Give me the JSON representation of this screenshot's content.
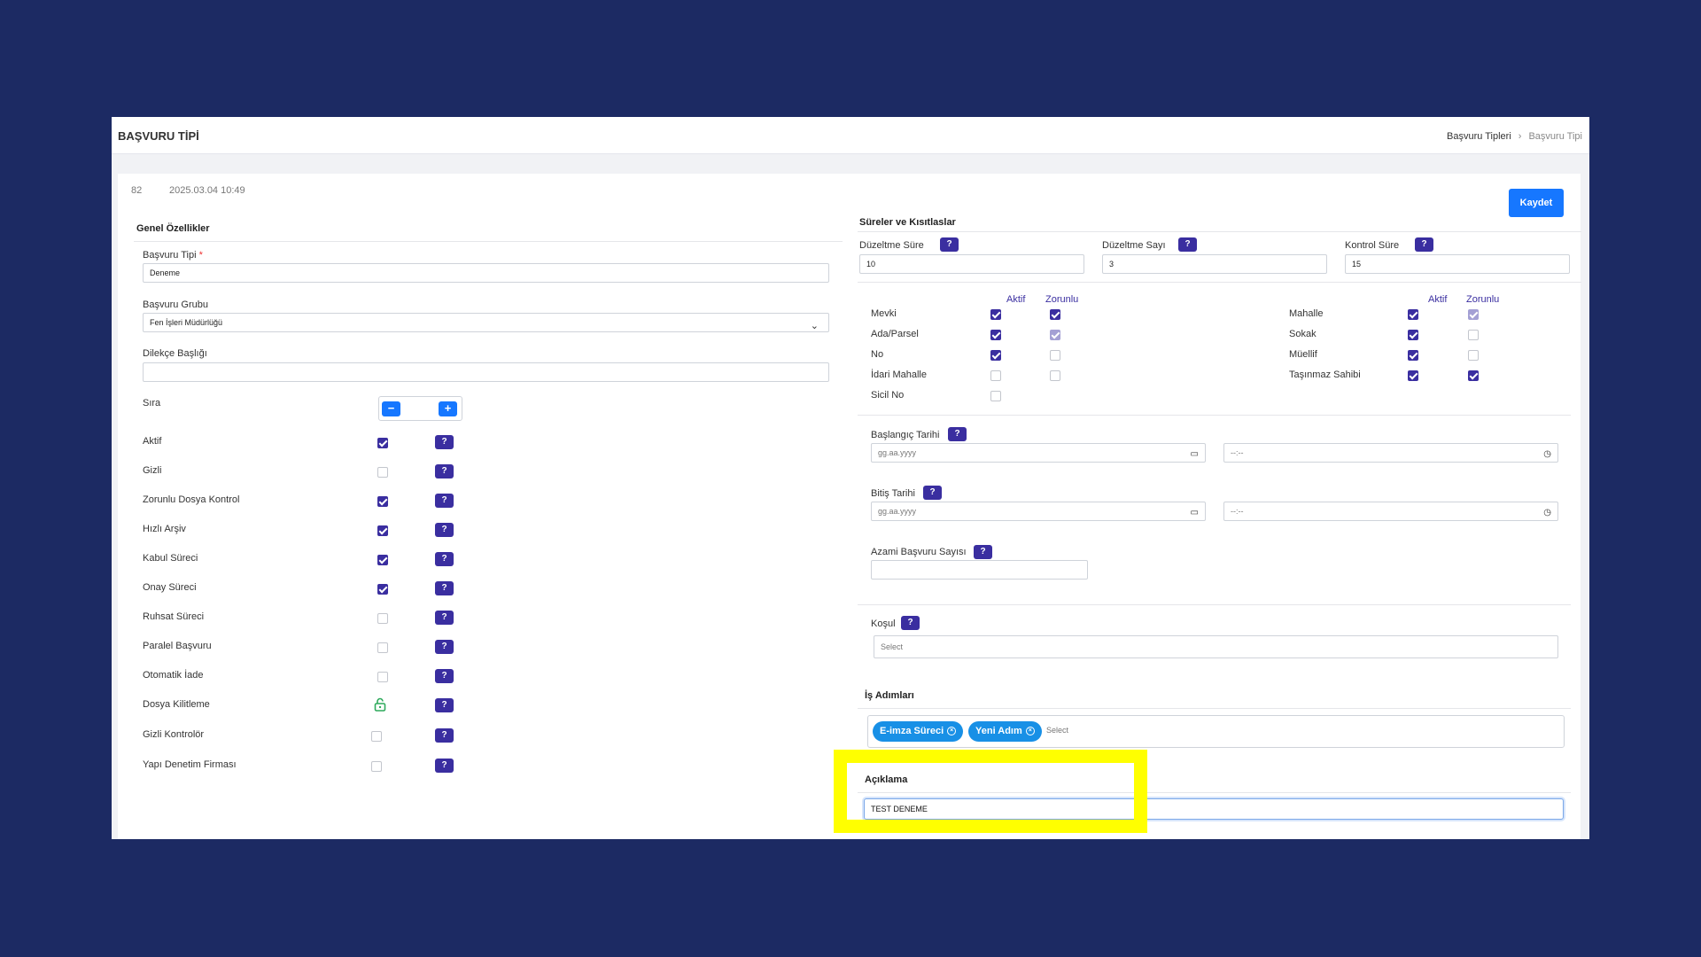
{
  "header": {
    "title": "BAŞVURU TİPİ",
    "breadcrumb": [
      "Başvuru Tipleri",
      "Başvuru Tipi"
    ]
  },
  "meta": {
    "id": "82",
    "date": "2025.03.04 10:49"
  },
  "actions": {
    "save_label": "Kaydet"
  },
  "general": {
    "title": "Genel Özellikler",
    "basvuru_tipi": {
      "label": "Başvuru Tipi",
      "required": "*",
      "value": "Deneme"
    },
    "basvuru_grubu": {
      "label": "Başvuru Grubu",
      "value": "Fen İşleri Müdürlüğü"
    },
    "dilekce_basligi": {
      "label": "Dilekçe Başlığı",
      "value": ""
    },
    "sira": {
      "label": "Sıra",
      "minus": "−",
      "plus": "+"
    },
    "options": [
      {
        "label": "Aktif",
        "checked": true,
        "help": "?"
      },
      {
        "label": "Gizli",
        "checked": false,
        "help": "?"
      },
      {
        "label": "Zorunlu Dosya Kontrol",
        "checked": true,
        "help": "?"
      },
      {
        "label": "Hızlı Arşiv",
        "checked": true,
        "help": "?"
      },
      {
        "label": "Kabul Süreci",
        "checked": true,
        "help": "?"
      },
      {
        "label": "Onay Süreci",
        "checked": true,
        "help": "?"
      },
      {
        "label": "Ruhsat Süreci",
        "checked": false,
        "help": "?"
      },
      {
        "label": "Paralel Başvuru",
        "checked": false,
        "help": "?"
      },
      {
        "label": "Otomatik İade",
        "checked": false,
        "help": "?"
      },
      {
        "label": "Dosya Kilitleme",
        "icon": "unlock-icon",
        "help": "?"
      },
      {
        "label": "Gizli Kontrolör",
        "checked": false,
        "help": "?"
      },
      {
        "label": "Yapı Denetim Firması",
        "checked": false,
        "help": "?"
      }
    ]
  },
  "limits": {
    "title": "Süreler ve Kısıtlaslar",
    "duzeltme_sure": {
      "label": "Düzeltme Süre",
      "value": "10"
    },
    "duzeltme_sayi": {
      "label": "Düzeltme Sayı",
      "value": "3"
    },
    "kontrol_sure": {
      "label": "Kontrol Süre",
      "value": "15"
    },
    "col_aktif": "Aktif",
    "col_zorunlu": "Zorunlu",
    "left_fields": [
      {
        "label": "Mevki",
        "aktif": true,
        "zorunlu": true
      },
      {
        "label": "Ada/Parsel",
        "aktif": true,
        "zorunlu": "dim"
      },
      {
        "label": "No",
        "aktif": true,
        "zorunlu": false
      },
      {
        "label": "İdari Mahalle",
        "aktif": false,
        "zorunlu": false
      },
      {
        "label": "Sicil No",
        "aktif": false
      }
    ],
    "right_fields": [
      {
        "label": "Mahalle",
        "aktif": true,
        "zorunlu": "dim"
      },
      {
        "label": "Sokak",
        "aktif": true,
        "zorunlu": false
      },
      {
        "label": "Müellif",
        "aktif": true,
        "zorunlu": false
      },
      {
        "label": "Taşınmaz Sahibi",
        "aktif": true,
        "zorunlu": true
      }
    ],
    "baslangic": {
      "label": "Başlangıç Tarihi",
      "date_placeholder": "gg.aa.yyyy",
      "time_placeholder": "--:--"
    },
    "bitis": {
      "label": "Bitiş Tarihi",
      "date_placeholder": "gg.aa.yyyy",
      "time_placeholder": "--:--"
    },
    "azami": {
      "label": "Azami Başvuru Sayısı",
      "value": ""
    },
    "kosul": {
      "label": "Koşul",
      "placeholder": "Select"
    }
  },
  "steps": {
    "title": "İş Adımları",
    "tags": [
      "E-imza Süreci",
      "Yeni Adım"
    ],
    "placeholder": "Select"
  },
  "description": {
    "title": "Açıklama",
    "value": "TEST DENEME"
  },
  "colors": {
    "background": "#1c2a63",
    "primary": "#1677ff",
    "checkbox": "#3a2ea0",
    "tag": "#1890e6",
    "highlight": "#ffff00"
  }
}
